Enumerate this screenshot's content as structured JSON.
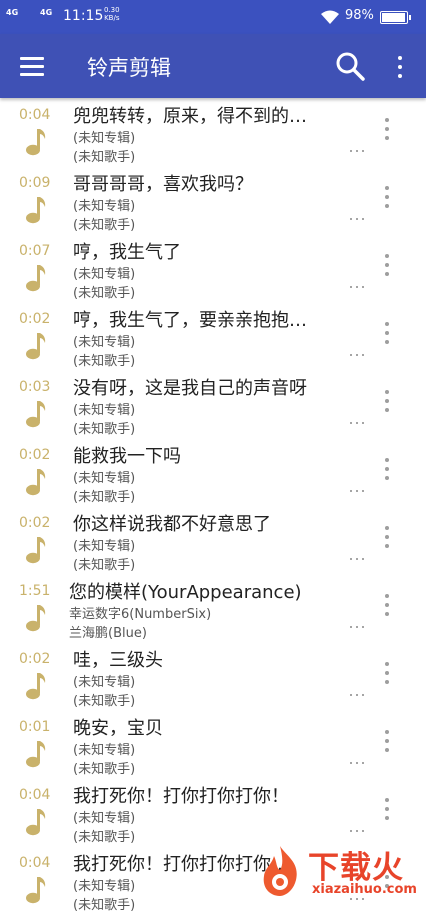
{
  "status_bar": {
    "signal1": "4G",
    "signal2": "4G",
    "time": "11:15",
    "speed_value": "0.30",
    "speed_unit": "KB/s",
    "battery": "98%",
    "battery_level": 0.98
  },
  "app_bar": {
    "title": "铃声剪辑",
    "menu_icon": "hamburger-menu-icon",
    "search_icon": "search-icon",
    "more_icon": "more-vert-icon"
  },
  "accent_color": "#3f51b5",
  "duration_color": "#c9b26b",
  "songs": [
    {
      "duration": "0:04",
      "title": "兜兜转转，原来，得不到的…",
      "album": "(未知专辑)",
      "artist": "(未知歌手)"
    },
    {
      "duration": "0:09",
      "title": "哥哥哥哥，喜欢我吗？",
      "album": "(未知专辑)",
      "artist": "(未知歌手)"
    },
    {
      "duration": "0:07",
      "title": "哼，我生气了",
      "album": "(未知专辑)",
      "artist": "(未知歌手)"
    },
    {
      "duration": "0:02",
      "title": "哼，我生气了，要亲亲抱抱…",
      "album": "(未知专辑)",
      "artist": "(未知歌手)"
    },
    {
      "duration": "0:03",
      "title": "没有呀，这是我自己的声音呀",
      "album": "(未知专辑)",
      "artist": "(未知歌手)"
    },
    {
      "duration": "0:02",
      "title": "能救我一下吗",
      "album": "(未知专辑)",
      "artist": "(未知歌手)"
    },
    {
      "duration": "0:02",
      "title": "你这样说我都不好意思了",
      "album": "(未知专辑)",
      "artist": "(未知歌手)"
    },
    {
      "duration": "1:51",
      "title": "您的模样(YourAppearance)",
      "album": "幸运数字6(NumberSix)",
      "artist": "兰海鹏(Blue)"
    },
    {
      "duration": "0:02",
      "title": "哇，三级头",
      "album": "(未知专辑)",
      "artist": "(未知歌手)"
    },
    {
      "duration": "0:01",
      "title": "晚安，宝贝",
      "album": "(未知专辑)",
      "artist": "(未知歌手)"
    },
    {
      "duration": "0:04",
      "title": "我打死你！打你打你打你！",
      "album": "(未知专辑)",
      "artist": "(未知歌手)"
    },
    {
      "duration": "0:04",
      "title": "我打死你！打你打你打你…",
      "album": "(未知专辑)",
      "artist": "(未知歌手)"
    }
  ],
  "watermark": {
    "text": "下载火",
    "url": "xiazaihuo.com"
  }
}
